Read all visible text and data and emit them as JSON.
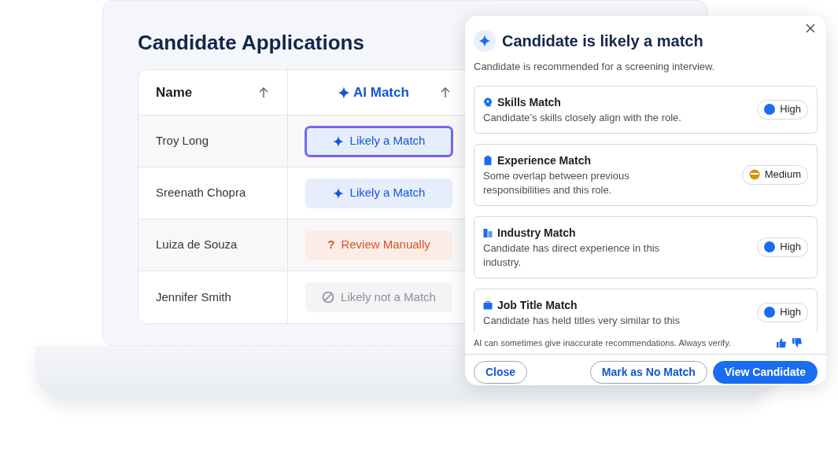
{
  "page": {
    "title": "Candidate Applications"
  },
  "table": {
    "columns": [
      {
        "label": "Name",
        "kind": "plain"
      },
      {
        "label": "AI Match",
        "kind": "ai"
      }
    ],
    "rows": [
      {
        "name": "Troy Long",
        "match": "Likely a Match",
        "kind": "match",
        "selected": true
      },
      {
        "name": "Sreenath Chopra",
        "match": "Likely a Match",
        "kind": "match",
        "selected": false
      },
      {
        "name": "Luiza de Souza",
        "match": "Review Manually",
        "symbol": "?",
        "kind": "review",
        "selected": false
      },
      {
        "name": "Jennifer Smith",
        "match": "Likely not a Match",
        "kind": "not_match",
        "selected": false
      }
    ]
  },
  "popup": {
    "title": "Candidate is likely a match",
    "subtitle": "Candidate is recommended for a screening interview.",
    "criteria": [
      {
        "title": "Skills Match",
        "description": "Candidate’s skills closely align with the role.",
        "rating": "High",
        "kind": "high"
      },
      {
        "title": "Experience Match",
        "description": "Some overlap between previous responsibilities and this role.",
        "rating": "Medium",
        "kind": "medium"
      },
      {
        "title": "Industry Match",
        "description": "Candidate has direct experience in this industry.",
        "rating": "High",
        "kind": "high"
      },
      {
        "title": "Job Title Match",
        "description": "Candidate has held titles very similar to this",
        "rating": "High",
        "kind": "high"
      }
    ],
    "disclaimer": "AI can sometimes give inaccurate recommendations. Always verify.",
    "buttons": [
      {
        "label": "Close",
        "kind": "outline"
      },
      {
        "label": "Mark as No Match",
        "kind": "outline"
      },
      {
        "label": "View Candidate",
        "kind": "primary"
      }
    ]
  }
}
